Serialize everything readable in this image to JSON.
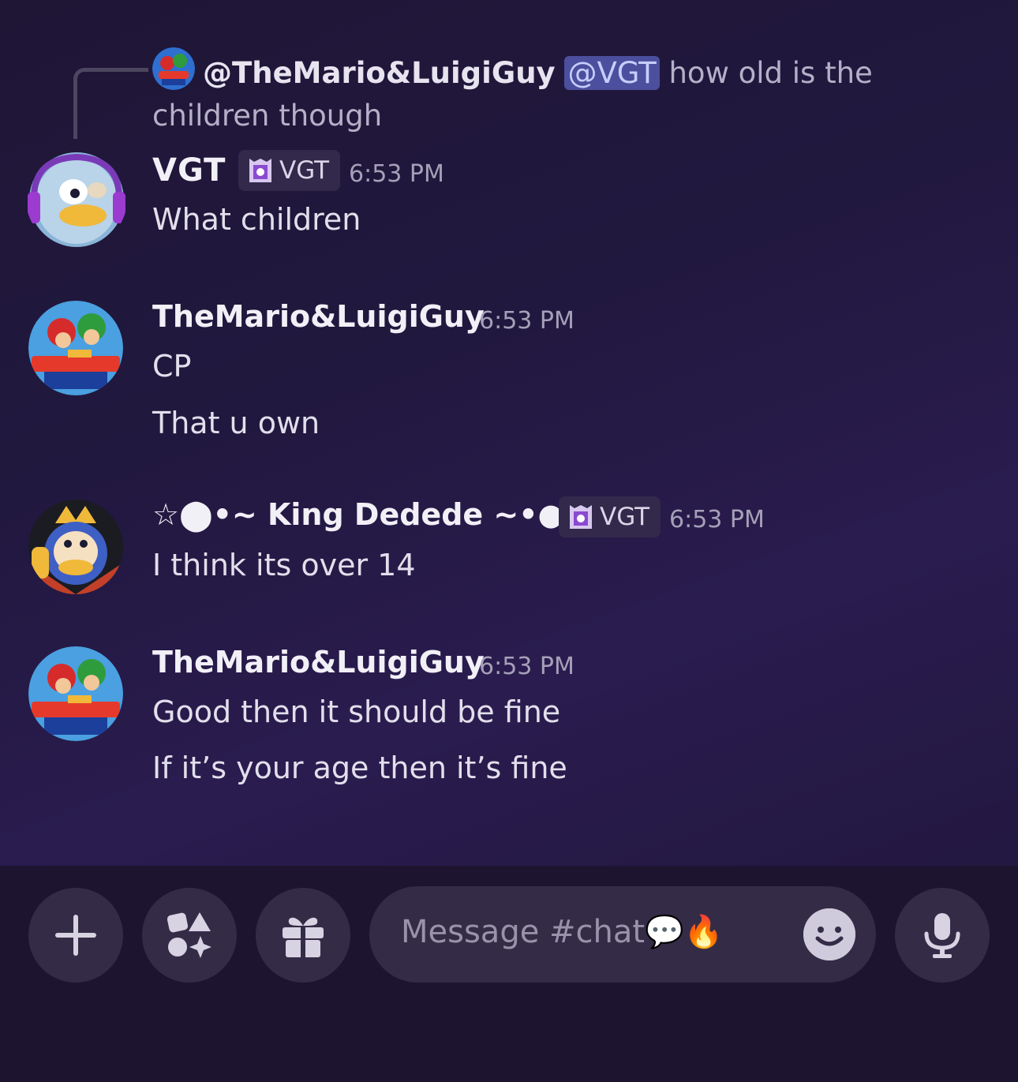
{
  "reply": {
    "author": "@TheMario&LuigiGuy",
    "mention": "@VGT",
    "text": "how old is the children though"
  },
  "messages": [
    {
      "author": "VGT",
      "badge": "VGT",
      "time": "6:53 PM",
      "lines": [
        "What children"
      ]
    },
    {
      "author": "TheMario&LuigiGuy",
      "time": "6:53 PM",
      "lines": [
        "CP",
        "That u own"
      ]
    },
    {
      "author": "☆⬤•~ King Dedede ~•●☆",
      "badge": "VGT",
      "time": "6:53 PM",
      "lines": [
        "I think its over 14"
      ]
    },
    {
      "author": "TheMario&LuigiGuy",
      "time": "6:53 PM",
      "lines": [
        "Good then it should be fine",
        "If it’s your age then it’s fine"
      ]
    }
  ],
  "composer": {
    "placeholder": "Message #chat💬🔥",
    "icons": [
      "plus-icon",
      "apps-icon",
      "gift-icon",
      "emoji-icon",
      "microphone-icon"
    ]
  },
  "colors": {
    "background": "#211839",
    "mention_bg": "#4b4f9d",
    "badge_bg": "#33294b",
    "button_bg": "#342c47"
  }
}
